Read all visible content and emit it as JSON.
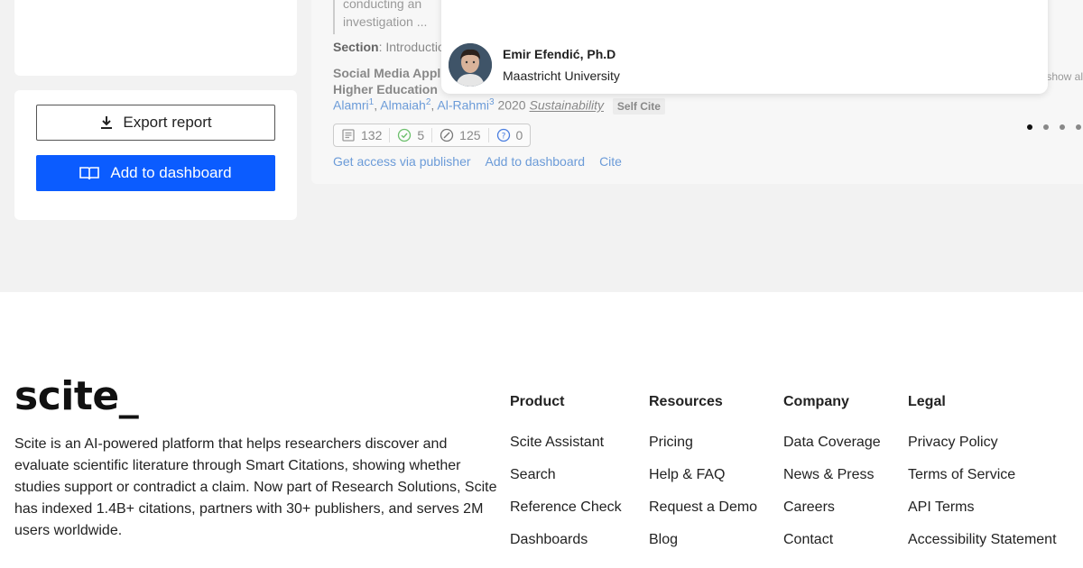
{
  "sidebar": {
    "export_label": "Export report",
    "add_dashboard_label": "Add to dashboard"
  },
  "citation": {
    "snippet": "conducting an investigation ... both academic pe",
    "section_label": "Section",
    "section_value": ": Introductio",
    "pub_title": "Social Media Appli Higher Education",
    "authors": [
      {
        "name": "Alamri",
        "sup": "1"
      },
      {
        "name": "Almaiah",
        "sup": "2"
      },
      {
        "name": "Al-Rahmi",
        "sup": "3"
      }
    ],
    "year": "2020",
    "journal": "Sustainability",
    "badge": "Self Cite",
    "stats": {
      "publications": "132",
      "supporting": "5",
      "mentioning": "125",
      "contrasting": "0"
    },
    "actions": [
      "Get access via publisher",
      "Add to dashboard",
      "Cite"
    ],
    "show_all": "show al"
  },
  "popover": {
    "name": "Emir Efendić, Ph.D",
    "affiliation": "Maastricht University"
  },
  "carousel": {
    "count": 4,
    "active": 0
  },
  "footer": {
    "logo": "scite_",
    "about": "Scite is an AI-powered platform that helps researchers discover and evaluate scientific literature through Smart Citations, showing whether studies support or contradict a claim. Now part of Research Solutions, Scite has indexed 1.4B+ citations, partners with 30+ publishers, and serves 2M users worldwide.",
    "columns": [
      {
        "title": "Product",
        "links": [
          "Scite Assistant",
          "Search",
          "Reference Check",
          "Dashboards"
        ]
      },
      {
        "title": "Resources",
        "links": [
          "Pricing",
          "Help & FAQ",
          "Request a Demo",
          "Blog"
        ]
      },
      {
        "title": "Company",
        "links": [
          "Data Coverage",
          "News & Press",
          "Careers",
          "Contact"
        ]
      },
      {
        "title": "Legal",
        "links": [
          "Privacy Policy",
          "Terms of Service",
          "API Terms",
          "Accessibility Statement"
        ]
      }
    ]
  },
  "colors": {
    "primary": "#0b5cff",
    "link": "#6b9bd8",
    "page_bg": "#f2f2f2"
  }
}
